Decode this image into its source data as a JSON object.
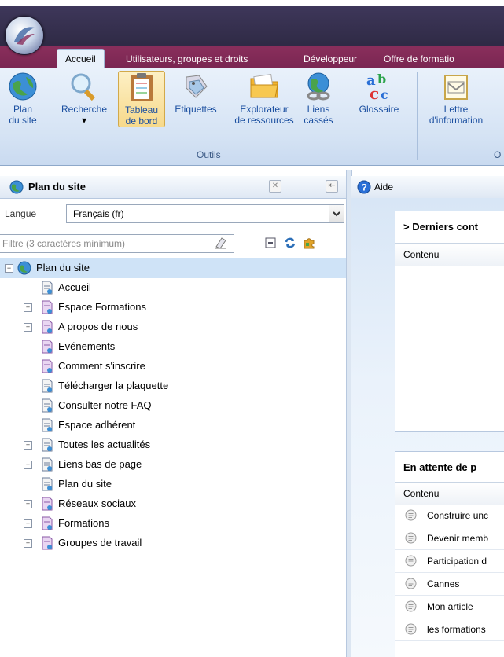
{
  "ribbon": {
    "tabs": [
      "Accueil",
      "Utilisateurs, groupes et droits",
      "Développeur",
      "Offre de formatio"
    ],
    "buttons": [
      {
        "label1": "Plan",
        "label2": "du site"
      },
      {
        "label1": "Recherche",
        "label2": "▾"
      },
      {
        "label1": "Tableau",
        "label2": "de bord"
      },
      {
        "label1": "Etiquettes",
        "label2": ""
      },
      {
        "label1": "Explorateur",
        "label2": "de ressources"
      },
      {
        "label1": "Liens",
        "label2": "cassés"
      },
      {
        "label1": "Glossaire",
        "label2": ""
      },
      {
        "label1": "Lettre",
        "label2": "d'information"
      }
    ],
    "group_tools": "Outils",
    "group_other": "O"
  },
  "left_panel": {
    "title": "Plan du site",
    "lang_label": "Langue",
    "lang_value": "Français (fr)",
    "filter_placeholder": "Filtre (3 caractères minimum)",
    "tree": [
      {
        "label": "Plan du site",
        "level": 0,
        "expand": "−",
        "selected": true
      },
      {
        "label": "Accueil",
        "level": 1,
        "expand": ""
      },
      {
        "label": "Espace Formations",
        "level": 1,
        "expand": "+"
      },
      {
        "label": "A propos de nous",
        "level": 1,
        "expand": "+"
      },
      {
        "label": "Evénements",
        "level": 1,
        "expand": ""
      },
      {
        "label": "Comment s'inscrire",
        "level": 1,
        "expand": ""
      },
      {
        "label": "Télécharger la plaquette",
        "level": 1,
        "expand": ""
      },
      {
        "label": "Consulter notre FAQ",
        "level": 1,
        "expand": ""
      },
      {
        "label": "Espace adhérent",
        "level": 1,
        "expand": ""
      },
      {
        "label": "Toutes les actualités",
        "level": 1,
        "expand": "+"
      },
      {
        "label": "Liens bas de page",
        "level": 1,
        "expand": "+"
      },
      {
        "label": "Plan du site",
        "level": 1,
        "expand": ""
      },
      {
        "label": "Réseaux sociaux",
        "level": 1,
        "expand": "+"
      },
      {
        "label": "Formations",
        "level": 1,
        "expand": "+"
      },
      {
        "label": "Groupes de travail",
        "level": 1,
        "expand": "+"
      }
    ]
  },
  "right_panel": {
    "tab_label": "Aide",
    "box1_title": "> Derniers cont",
    "box1_col": "Contenu",
    "box2_title": "En attente de p",
    "box2_col": "Contenu",
    "box2_items": [
      "Construire unc",
      "Devenir memb",
      "Participation d",
      "Cannes",
      "Mon article",
      "les formations"
    ]
  }
}
